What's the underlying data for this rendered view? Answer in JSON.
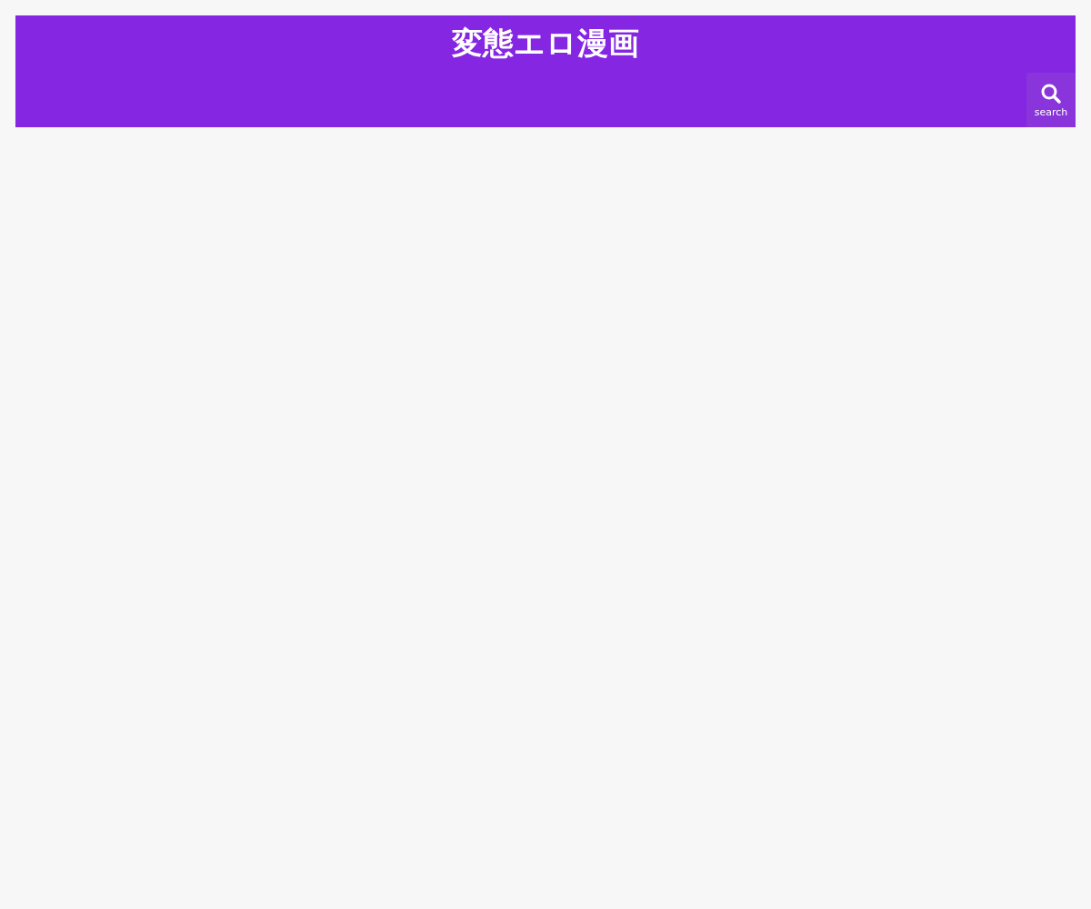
{
  "header": {
    "site_title": "変態エロ漫画",
    "search_button": {
      "label": "search"
    }
  }
}
